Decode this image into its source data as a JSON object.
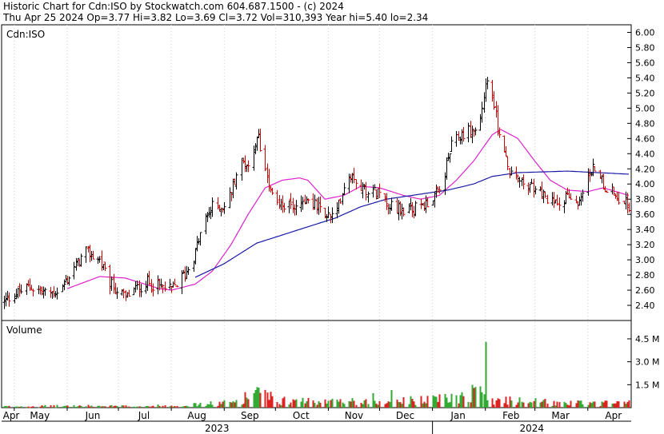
{
  "header": {
    "line1": "Historic Chart for Cdn:ISO by Stockwatch.com 604.687.1500 - (c) 2024",
    "line2": "Thu Apr 25 2024  Op=3.77  Hi=3.82  Lo=3.69  Cl=3.72  Vol=310,393  Year hi=5.40  lo=2.34"
  },
  "chart_data": {
    "type": "candlestick-bar",
    "symbol_label": "Cdn:ISO",
    "volume_label": "Volume",
    "price_ylim": [
      2.2,
      6.1
    ],
    "price_ticks": [
      "6.00",
      "5.80",
      "5.60",
      "5.40",
      "5.20",
      "5.00",
      "4.80",
      "4.60",
      "4.40",
      "4.20",
      "4.00",
      "3.80",
      "3.60",
      "3.40",
      "3.20",
      "3.00",
      "2.80",
      "2.60",
      "2.40"
    ],
    "volume_ylim": [
      0,
      5.7
    ],
    "volume_ticks": [
      "4.5 M",
      "3.0 M",
      "1.5 M"
    ],
    "months": [
      "Apr",
      "May",
      "Jun",
      "Jul",
      "Aug",
      "Sep",
      "Oct",
      "Nov",
      "Dec",
      "Jan",
      "Feb",
      "Mar",
      "Apr"
    ],
    "years": [
      "2023",
      "2024"
    ],
    "close_anchors": [
      [
        "2023-04-25",
        2.45
      ],
      [
        "2023-05-01",
        2.55
      ],
      [
        "2023-05-10",
        2.65
      ],
      [
        "2023-05-20",
        2.55
      ],
      [
        "2023-05-28",
        2.6
      ],
      [
        "2023-06-05",
        2.9
      ],
      [
        "2023-06-12",
        3.1
      ],
      [
        "2023-06-20",
        3.0
      ],
      [
        "2023-06-25",
        2.7
      ],
      [
        "2023-07-05",
        2.5
      ],
      [
        "2023-07-10",
        2.6
      ],
      [
        "2023-07-18",
        2.7
      ],
      [
        "2023-07-25",
        2.65
      ],
      [
        "2023-08-01",
        2.6
      ],
      [
        "2023-08-10",
        2.85
      ],
      [
        "2023-08-15",
        3.1
      ],
      [
        "2023-08-20",
        3.5
      ],
      [
        "2023-08-25",
        3.7
      ],
      [
        "2023-09-01",
        3.7
      ],
      [
        "2023-09-05",
        3.9
      ],
      [
        "2023-09-10",
        4.3
      ],
      [
        "2023-09-15",
        4.25
      ],
      [
        "2023-09-19",
        4.5
      ],
      [
        "2023-09-21",
        4.6
      ],
      [
        "2023-09-25",
        4.2
      ],
      [
        "2023-10-01",
        3.75
      ],
      [
        "2023-10-10",
        3.7
      ],
      [
        "2023-10-20",
        3.8
      ],
      [
        "2023-10-30",
        3.6
      ],
      [
        "2023-11-05",
        3.55
      ],
      [
        "2023-11-10",
        4.0
      ],
      [
        "2023-11-15",
        4.15
      ],
      [
        "2023-11-20",
        3.95
      ],
      [
        "2023-11-30",
        3.9
      ],
      [
        "2023-12-08",
        3.7
      ],
      [
        "2023-12-15",
        3.65
      ],
      [
        "2023-12-25",
        3.7
      ],
      [
        "2024-01-05",
        3.9
      ],
      [
        "2024-01-12",
        4.5
      ],
      [
        "2024-01-20",
        4.7
      ],
      [
        "2024-01-28",
        4.7
      ],
      [
        "2024-02-01",
        5.35
      ],
      [
        "2024-02-05",
        5.2
      ],
      [
        "2024-02-08",
        4.75
      ],
      [
        "2024-02-15",
        4.15
      ],
      [
        "2024-02-22",
        4.0
      ],
      [
        "2024-03-01",
        3.95
      ],
      [
        "2024-03-10",
        3.75
      ],
      [
        "2024-03-20",
        3.85
      ],
      [
        "2024-03-25",
        3.7
      ],
      [
        "2024-04-01",
        4.1
      ],
      [
        "2024-04-06",
        4.25
      ],
      [
        "2024-04-10",
        4.0
      ],
      [
        "2024-04-15",
        3.9
      ],
      [
        "2024-04-20",
        3.8
      ],
      [
        "2024-04-25",
        3.72
      ]
    ],
    "volume_anchors": [
      [
        "2023-04-25",
        0.08
      ],
      [
        "2023-06-01",
        0.12
      ],
      [
        "2023-07-15",
        0.1
      ],
      [
        "2023-08-15",
        0.2
      ],
      [
        "2023-09-05",
        0.35
      ],
      [
        "2023-09-20",
        1.0
      ],
      [
        "2023-10-05",
        0.45
      ],
      [
        "2023-11-01",
        0.4
      ],
      [
        "2023-11-25",
        0.45
      ],
      [
        "2023-12-15",
        0.45
      ],
      [
        "2024-01-10",
        0.6
      ],
      [
        "2024-01-25",
        1.1
      ],
      [
        "2024-02-08",
        0.5
      ],
      [
        "2024-03-01",
        0.4
      ],
      [
        "2024-03-20",
        0.3
      ],
      [
        "2024-04-25",
        0.3
      ]
    ],
    "volume_spikes": [
      [
        "2023-09-18",
        0.95
      ],
      [
        "2023-09-19",
        1.15
      ],
      [
        "2024-01-21",
        1.0
      ],
      [
        "2024-01-30",
        1.0
      ],
      [
        "2024-02-01",
        4.3
      ],
      [
        "2023-12-08",
        1.15
      ],
      [
        "2023-11-18",
        0.9
      ],
      [
        "2023-11-27",
        0.95
      ],
      [
        "2023-12-19",
        0.75
      ]
    ],
    "ma_short_anchors": [
      [
        "2023-06-01",
        2.62
      ],
      [
        "2023-06-20",
        2.78
      ],
      [
        "2023-07-05",
        2.76
      ],
      [
        "2023-07-25",
        2.62
      ],
      [
        "2023-08-01",
        2.6
      ],
      [
        "2023-08-15",
        2.68
      ],
      [
        "2023-08-25",
        2.85
      ],
      [
        "2023-09-05",
        3.2
      ],
      [
        "2023-09-15",
        3.6
      ],
      [
        "2023-09-25",
        3.95
      ],
      [
        "2023-10-05",
        4.05
      ],
      [
        "2023-10-15",
        4.08
      ],
      [
        "2023-10-20",
        4.05
      ],
      [
        "2023-10-30",
        3.8
      ],
      [
        "2023-11-10",
        3.85
      ],
      [
        "2023-11-20",
        3.97
      ],
      [
        "2023-12-01",
        3.95
      ],
      [
        "2023-12-15",
        3.85
      ],
      [
        "2023-12-25",
        3.8
      ],
      [
        "2024-01-05",
        3.85
      ],
      [
        "2024-01-15",
        4.05
      ],
      [
        "2024-01-25",
        4.3
      ],
      [
        "2024-02-05",
        4.65
      ],
      [
        "2024-02-10",
        4.72
      ],
      [
        "2024-02-20",
        4.6
      ],
      [
        "2024-03-01",
        4.3
      ],
      [
        "2024-03-10",
        4.05
      ],
      [
        "2024-03-20",
        3.92
      ],
      [
        "2024-04-01",
        3.9
      ],
      [
        "2024-04-10",
        3.95
      ],
      [
        "2024-04-25",
        3.85
      ]
    ],
    "ma_long_anchors": [
      [
        "2023-08-15",
        2.77
      ],
      [
        "2023-09-01",
        2.95
      ],
      [
        "2023-09-20",
        3.22
      ],
      [
        "2023-10-15",
        3.4
      ],
      [
        "2023-11-05",
        3.55
      ],
      [
        "2023-11-20",
        3.7
      ],
      [
        "2023-12-05",
        3.8
      ],
      [
        "2023-12-20",
        3.85
      ],
      [
        "2024-01-10",
        3.92
      ],
      [
        "2024-01-25",
        4.0
      ],
      [
        "2024-02-05",
        4.1
      ],
      [
        "2024-02-20",
        4.15
      ],
      [
        "2024-03-20",
        4.17
      ],
      [
        "2024-04-25",
        4.13
      ]
    ],
    "colors": {
      "up_tick": "#000000",
      "down_tick": "#cc0000",
      "ma_short": "#dd22cc",
      "ma_long": "#1a1aa6",
      "vol_up": "#33aa33",
      "vol_down": "#dd2222",
      "frame": "#000000",
      "grid": "#cfcfcf"
    }
  }
}
